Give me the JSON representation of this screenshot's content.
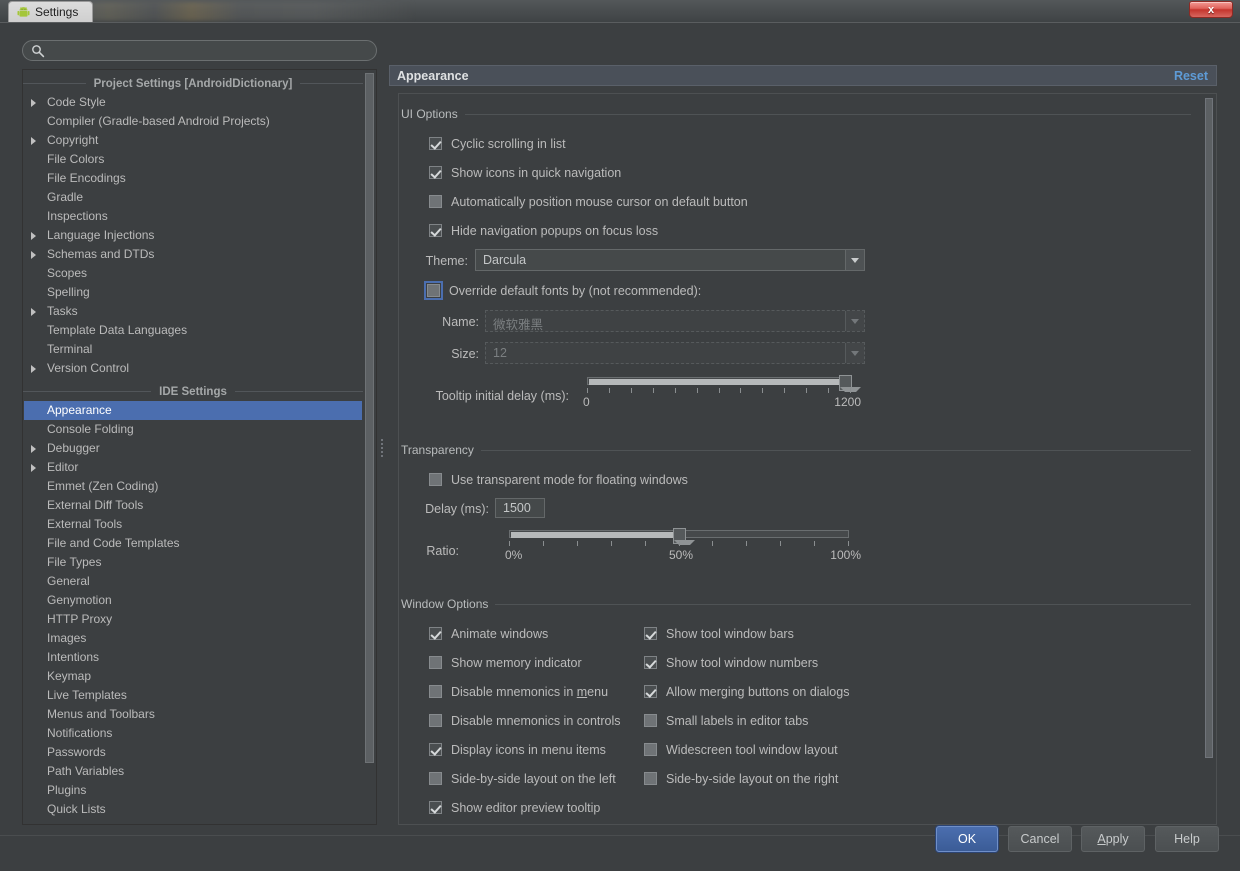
{
  "window": {
    "tab_label": "Settings",
    "app_icon": "android-icon",
    "close_label": "x"
  },
  "search": {
    "value": "",
    "placeholder": "",
    "icon": "search-icon"
  },
  "sidebar": {
    "groups": [
      {
        "title": "Project Settings [AndroidDictionary]",
        "items": [
          {
            "label": "Code Style",
            "expandable": true,
            "selected": false
          },
          {
            "label": "Compiler (Gradle-based Android Projects)",
            "expandable": false,
            "selected": false
          },
          {
            "label": "Copyright",
            "expandable": true,
            "selected": false
          },
          {
            "label": "File Colors",
            "expandable": false,
            "selected": false
          },
          {
            "label": "File Encodings",
            "expandable": false,
            "selected": false
          },
          {
            "label": "Gradle",
            "expandable": false,
            "selected": false
          },
          {
            "label": "Inspections",
            "expandable": false,
            "selected": false
          },
          {
            "label": "Language Injections",
            "expandable": true,
            "selected": false
          },
          {
            "label": "Schemas and DTDs",
            "expandable": true,
            "selected": false
          },
          {
            "label": "Scopes",
            "expandable": false,
            "selected": false
          },
          {
            "label": "Spelling",
            "expandable": false,
            "selected": false
          },
          {
            "label": "Tasks",
            "expandable": true,
            "selected": false
          },
          {
            "label": "Template Data Languages",
            "expandable": false,
            "selected": false
          },
          {
            "label": "Terminal",
            "expandable": false,
            "selected": false
          },
          {
            "label": "Version Control",
            "expandable": true,
            "selected": false
          }
        ]
      },
      {
        "title": "IDE Settings",
        "items": [
          {
            "label": "Appearance",
            "expandable": false,
            "selected": true
          },
          {
            "label": "Console Folding",
            "expandable": false,
            "selected": false
          },
          {
            "label": "Debugger",
            "expandable": true,
            "selected": false
          },
          {
            "label": "Editor",
            "expandable": true,
            "selected": false
          },
          {
            "label": "Emmet (Zen Coding)",
            "expandable": false,
            "selected": false
          },
          {
            "label": "External Diff Tools",
            "expandable": false,
            "selected": false
          },
          {
            "label": "External Tools",
            "expandable": false,
            "selected": false
          },
          {
            "label": "File and Code Templates",
            "expandable": false,
            "selected": false
          },
          {
            "label": "File Types",
            "expandable": false,
            "selected": false
          },
          {
            "label": "General",
            "expandable": false,
            "selected": false
          },
          {
            "label": "Genymotion",
            "expandable": false,
            "selected": false
          },
          {
            "label": "HTTP Proxy",
            "expandable": false,
            "selected": false
          },
          {
            "label": "Images",
            "expandable": false,
            "selected": false
          },
          {
            "label": "Intentions",
            "expandable": false,
            "selected": false
          },
          {
            "label": "Keymap",
            "expandable": false,
            "selected": false
          },
          {
            "label": "Live Templates",
            "expandable": false,
            "selected": false
          },
          {
            "label": "Menus and Toolbars",
            "expandable": false,
            "selected": false
          },
          {
            "label": "Notifications",
            "expandable": false,
            "selected": false
          },
          {
            "label": "Passwords",
            "expandable": false,
            "selected": false
          },
          {
            "label": "Path Variables",
            "expandable": false,
            "selected": false
          },
          {
            "label": "Plugins",
            "expandable": false,
            "selected": false
          },
          {
            "label": "Quick Lists",
            "expandable": false,
            "selected": false
          }
        ]
      }
    ]
  },
  "panel": {
    "title": "Appearance",
    "reset_label": "Reset",
    "ui_options": {
      "section_label": "UI Options",
      "checkboxes": [
        {
          "label": "Cyclic scrolling in list",
          "checked": true
        },
        {
          "label": "Show icons in quick navigation",
          "checked": true
        },
        {
          "label": "Automatically position mouse cursor on default button",
          "checked": false
        },
        {
          "label": "Hide navigation popups on focus loss",
          "checked": true
        }
      ],
      "theme_label": "Theme:",
      "theme_value": "Darcula",
      "override_fonts_label": "Override default fonts by (not recommended):",
      "override_fonts_checked": false,
      "name_label": "Name:",
      "name_value": "微软雅黑",
      "size_label": "Size:",
      "size_value": "12",
      "tooltip_delay_label": "Tooltip initial delay (ms):",
      "tooltip_delay_min_label": "0",
      "tooltip_delay_max_label": "1200",
      "tooltip_delay_value": 1200
    },
    "transparency": {
      "section_label": "Transparency",
      "transparent_mode_label": "Use transparent mode for floating windows",
      "transparent_mode_checked": false,
      "delay_label": "Delay (ms):",
      "delay_value": "1500",
      "ratio_label": "Ratio:",
      "ratio_min_label": "0%",
      "ratio_mid_label": "50%",
      "ratio_max_label": "100%",
      "ratio_value": 50
    },
    "window_options": {
      "section_label": "Window Options",
      "left_column": [
        {
          "label": "Animate windows",
          "checked": true
        },
        {
          "label": "Show memory indicator",
          "checked": false
        },
        {
          "label": "Disable mnemonics in menu",
          "checked": false,
          "mnemonic": "m"
        },
        {
          "label": "Disable mnemonics in controls",
          "checked": false
        },
        {
          "label": "Display icons in menu items",
          "checked": true
        },
        {
          "label": "Side-by-side layout on the left",
          "checked": false
        },
        {
          "label": "Show editor preview tooltip",
          "checked": true
        }
      ],
      "right_column": [
        {
          "label": "Show tool window bars",
          "checked": true
        },
        {
          "label": "Show tool window numbers",
          "checked": true
        },
        {
          "label": "Allow merging buttons on dialogs",
          "checked": true
        },
        {
          "label": "Small labels in editor tabs",
          "checked": false
        },
        {
          "label": "Widescreen tool window layout",
          "checked": false
        },
        {
          "label": "Side-by-side layout on the right",
          "checked": false
        }
      ]
    }
  },
  "buttons": {
    "ok": "OK",
    "cancel": "Cancel",
    "apply": "Apply",
    "apply_mnemonic": "A",
    "help": "Help"
  },
  "colors": {
    "accent": "#4b6eaf",
    "link": "#5e9bd6",
    "background": "#3c3f41",
    "text": "#bbbbbb"
  }
}
